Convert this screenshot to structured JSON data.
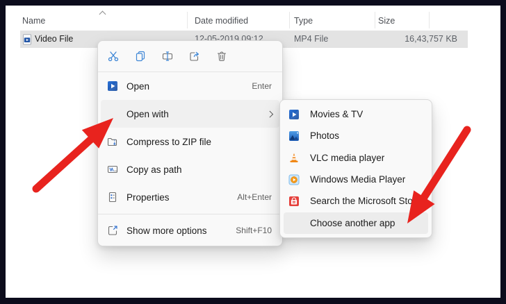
{
  "colors": {
    "arrow_red": "#e8231e",
    "selection_gray": "#e3e3e3",
    "menu_background": "#f9f9f9",
    "menu_highlight": "#f0f0f0",
    "frame_border": "#0c0c1c"
  },
  "file_list": {
    "columns": [
      {
        "label": "Name",
        "sorted": "ascending"
      },
      {
        "label": "Date modified"
      },
      {
        "label": "Type"
      },
      {
        "label": "Size"
      }
    ],
    "rows": [
      {
        "icon": "video-file-icon",
        "name": "Video File",
        "date_modified": "12-05-2019 09:12",
        "type": "MP4 File",
        "size": "16,43,757 KB",
        "selected": true
      }
    ]
  },
  "context_menu": {
    "quick_actions": [
      {
        "name": "Cut",
        "icon": "cut-icon"
      },
      {
        "name": "Copy",
        "icon": "copy-icon"
      },
      {
        "name": "Rename",
        "icon": "rename-icon"
      },
      {
        "name": "Share",
        "icon": "share-icon"
      },
      {
        "name": "Delete",
        "icon": "delete-icon"
      }
    ],
    "items": [
      {
        "label": "Open",
        "icon": "movies-tv-app-icon",
        "shortcut": "Enter"
      },
      {
        "label": "Open with",
        "has_submenu": true,
        "state": "hovered"
      },
      {
        "label": "Compress to ZIP file",
        "icon": "zip-folder-icon"
      },
      {
        "label": "Copy as path",
        "icon": "copy-as-path-icon"
      },
      {
        "label": "Properties",
        "icon": "properties-icon",
        "shortcut": "Alt+Enter"
      },
      {
        "label": "Show more options",
        "icon": "show-more-options-icon",
        "shortcut": "Shift+F10"
      }
    ]
  },
  "open_with_submenu": {
    "items": [
      {
        "label": "Movies & TV",
        "icon": "movies-tv-app-icon"
      },
      {
        "label": "Photos",
        "icon": "photos-app-icon"
      },
      {
        "label": "VLC media player",
        "icon": "vlc-icon"
      },
      {
        "label": "Windows Media Player",
        "icon": "windows-media-player-icon"
      },
      {
        "label": "Search the Microsoft Store",
        "icon": "microsoft-store-icon"
      },
      {
        "label": "Choose another app",
        "state": "highlighted"
      }
    ]
  },
  "annotations": {
    "arrows": [
      {
        "points_at": "Open with",
        "color": "#e8231e"
      },
      {
        "points_at": "Choose another app",
        "color": "#e8231e"
      }
    ]
  }
}
